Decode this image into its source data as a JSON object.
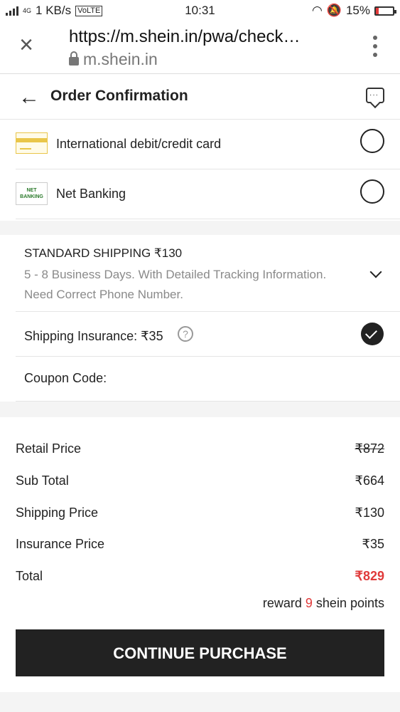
{
  "status_bar": {
    "network": "4G",
    "speed": "1 KB/s",
    "volte": "VoLTE",
    "time": "10:31",
    "battery": "15%",
    "battery_level": 0.15,
    "battery_color": "#e23a3a"
  },
  "browser": {
    "url": "https://m.shein.in/pwa/check…",
    "domain": "m.shein.in",
    "icons": [
      "close-icon",
      "lock-icon",
      "overflow-menu-icon"
    ]
  },
  "header": {
    "title": "Order Confirmation",
    "icons": [
      "back-arrow-icon",
      "chat-icon"
    ]
  },
  "payment_methods": [
    {
      "label": "International debit/credit card",
      "icon": "credit-card-icon",
      "selected": false
    },
    {
      "label": "Net Banking",
      "icon_text": "NET BANKING",
      "icon": "net-banking-icon",
      "selected": false
    }
  ],
  "shipping": {
    "title": "STANDARD SHIPPING ₹130",
    "description": "5 - 8 Business Days. With Detailed Tracking Information. Need Correct Phone Number.",
    "insurance_label": "Shipping Insurance: ₹35",
    "insurance_help": "?",
    "insurance_checked": true,
    "coupon_label": "Coupon Code:"
  },
  "summary": {
    "rows": [
      {
        "label": "Retail Price",
        "value": "₹872"
      },
      {
        "label": "Sub Total",
        "value": "₹664"
      },
      {
        "label": "Shipping Price",
        "value": "₹130"
      },
      {
        "label": "Insurance Price",
        "value": "₹35"
      },
      {
        "label": "Total",
        "value": "₹829"
      }
    ],
    "reward_prefix": "reward",
    "reward_points": "9",
    "reward_suffix": "shein points",
    "accent_color": "#e03a3a"
  },
  "cta_label": "CONTINUE PURCHASE"
}
